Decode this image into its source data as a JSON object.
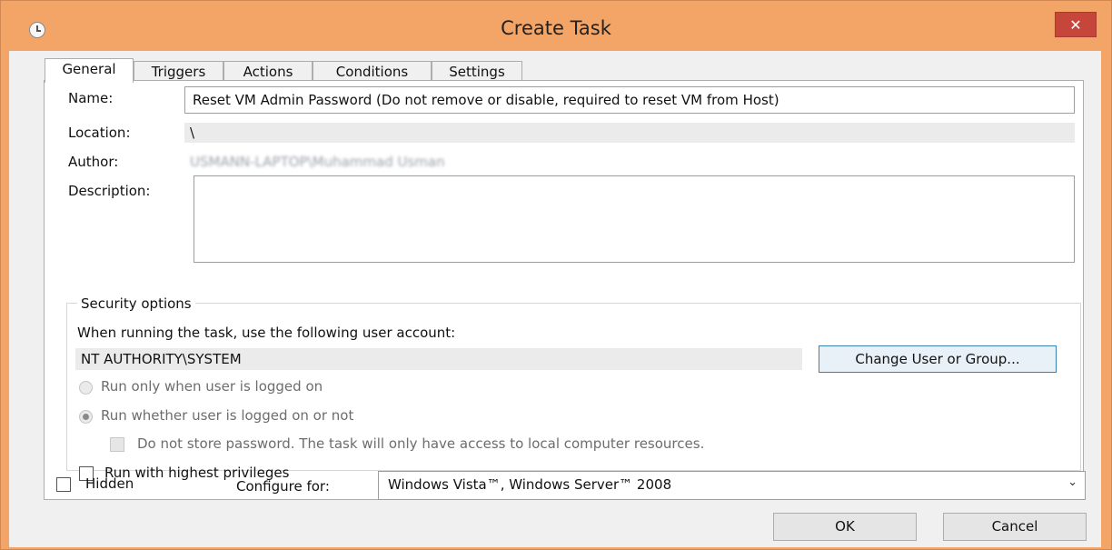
{
  "window": {
    "title": "Create Task",
    "close_glyph": "✕"
  },
  "tabs": [
    "General",
    "Triggers",
    "Actions",
    "Conditions",
    "Settings"
  ],
  "general": {
    "name_label": "Name:",
    "name_value": "Reset VM Admin Password (Do not remove or disable, required to reset VM from Host)",
    "location_label": "Location:",
    "location_value": "\\",
    "author_label": "Author:",
    "author_value": "USMANN-LAPTOP\\Muhammad Usman",
    "description_label": "Description:",
    "description_value": ""
  },
  "security": {
    "group_title": "Security options",
    "account_prompt": "When running the task, use the following user account:",
    "account_value": "NT AUTHORITY\\SYSTEM",
    "change_button": "Change User or Group...",
    "radio_logged_on": "Run only when user is logged on",
    "radio_whether": "Run whether user is logged on or not",
    "no_store_password": "Do not store password.  The task will only have access to local computer resources.",
    "highest_privileges": "Run with highest privileges"
  },
  "bottom": {
    "hidden_label": "Hidden",
    "configure_label": "Configure for:",
    "configure_value": "Windows Vista™, Windows Server™ 2008",
    "ok_button": "OK",
    "cancel_button": "Cancel"
  },
  "colors": {
    "titlebar": "#f2a567",
    "close": "#c7463b",
    "focus_border": "#3c7fb1"
  },
  "icons": [
    "task-scheduler-icon",
    "close-icon",
    "chevron-down-icon"
  ]
}
